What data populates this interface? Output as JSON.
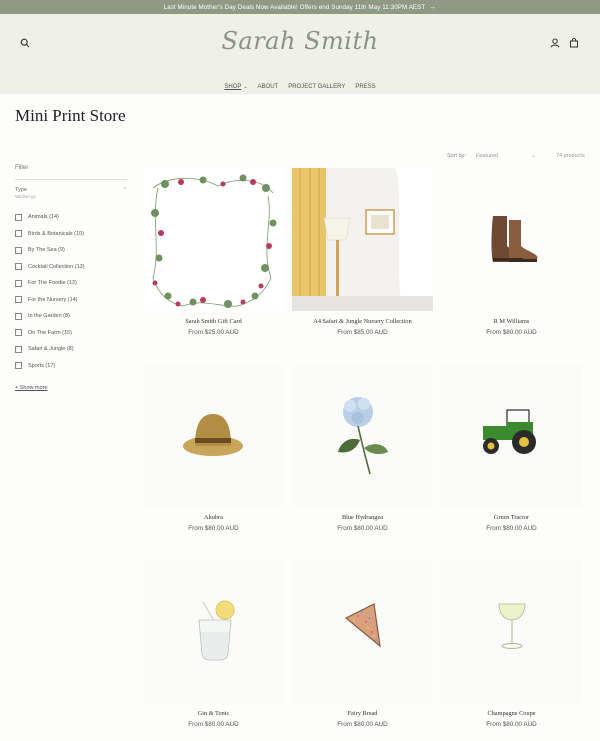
{
  "announcement": {
    "text": "Last Minute Mother's Day Deals Now Available! Offers end Sunday 11th May 11:30PM AEST",
    "arrow": "→"
  },
  "header": {
    "logo": "Sarah Smith",
    "nav": [
      {
        "label": "SHOP",
        "has_dropdown": true
      },
      {
        "label": "ABOUT"
      },
      {
        "label": "PROJECT GALLERY"
      },
      {
        "label": "PRESS"
      }
    ],
    "icons": [
      "search-icon",
      "account-icon",
      "cart-icon"
    ]
  },
  "page": {
    "title": "Mini Print Store"
  },
  "filter": {
    "label": "Filter",
    "type_title": "Type",
    "type_sub": "Wildset go",
    "options": [
      {
        "label": "Animals (14)"
      },
      {
        "label": "Birds & Botanicals (10)"
      },
      {
        "label": "By The Sea (9)"
      },
      {
        "label": "Cocktail Collection (13)"
      },
      {
        "label": "For The Foodie (13)"
      },
      {
        "label": "For the Nursery (14)"
      },
      {
        "label": "In the Garden (8)"
      },
      {
        "label": "On The Farm (15)"
      },
      {
        "label": "Safari & Jungle (8)"
      },
      {
        "label": "Sports (17)"
      }
    ],
    "show_more": "+ Show more"
  },
  "sort": {
    "label": "Sort by:",
    "value": "Featured",
    "count": "74 products"
  },
  "products": [
    {
      "title": "Sarah Smith Gift Card",
      "price": "From $25.00 AUD"
    },
    {
      "title": "A4 Safari & Jungle Nursery Collection",
      "price": "From $85.00 AUD"
    },
    {
      "title": "R M Williams",
      "price": "From $80.00 AUD"
    },
    {
      "title": "Akubra",
      "price": "From $80.00 AUD"
    },
    {
      "title": "Blue Hydrangea",
      "price": "From $80.00 AUD"
    },
    {
      "title": "Green Tractor",
      "price": "From $80.00 AUD"
    },
    {
      "title": "Gin & Tonic",
      "price": "From $80.00 AUD"
    },
    {
      "title": "Fairy Bread",
      "price": "From $80.00 AUD"
    },
    {
      "title": "Champagne Coupe",
      "price": "From $80.00 AUD"
    }
  ],
  "colors": {
    "announcement_bg": "#8f9a84",
    "header_bg": "#eff0e6",
    "logo": "#8a9384"
  }
}
